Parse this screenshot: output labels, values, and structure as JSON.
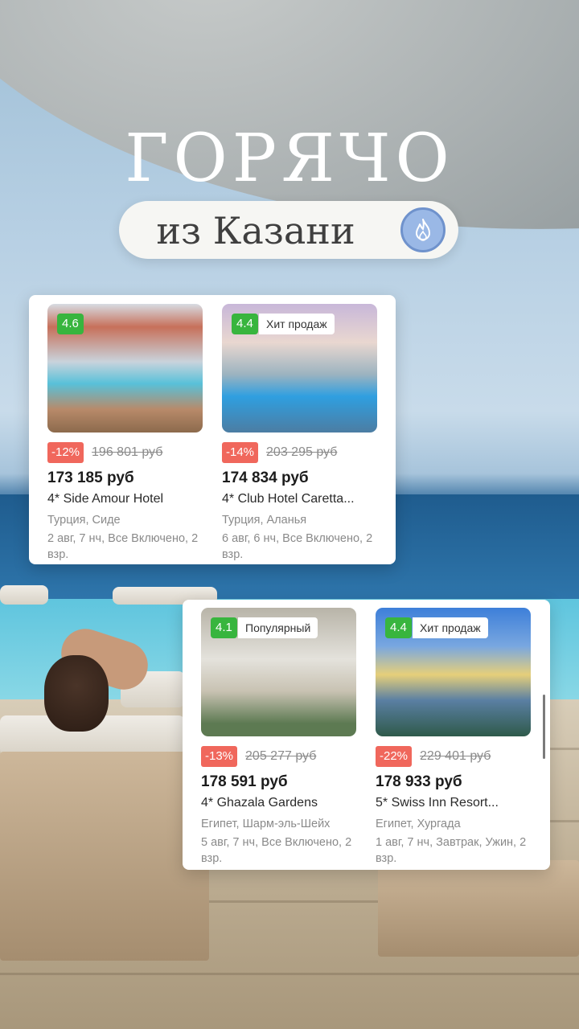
{
  "headline": "ГОРЯЧО",
  "subheadline": "из Казани",
  "icons": {
    "badge": "fire-icon"
  },
  "colors": {
    "rating": "#38b53e",
    "discount": "#f0675c",
    "pill_icon": "#9ab8e6"
  },
  "offers": [
    {
      "rating": "4.6",
      "tag": "",
      "discount": "-12%",
      "old_price": "196 801 руб",
      "price": "173 185 руб",
      "hotel": "4* Side Amour Hotel",
      "location": "Турция, Сиде",
      "details": "2 авг, 7 нч, Все Включено, 2 взр."
    },
    {
      "rating": "4.4",
      "tag": "Хит продаж",
      "discount": "-14%",
      "old_price": "203 295 руб",
      "price": "174 834 руб",
      "hotel": "4* Club Hotel Caretta...",
      "location": "Турция, Аланья",
      "details": "6 авг, 6 нч, Все Включено, 2 взр."
    },
    {
      "rating": "4.1",
      "tag": "Популярный",
      "discount": "-13%",
      "old_price": "205 277 руб",
      "price": "178 591 руб",
      "hotel": "4* Ghazala Gardens",
      "location": "Египет, Шарм-эль-Шейх",
      "details": "5 авг, 7 нч, Все Включено, 2 взр."
    },
    {
      "rating": "4.4",
      "tag": "Хит продаж",
      "discount": "-22%",
      "old_price": "229 401 руб",
      "price": "178 933 руб",
      "hotel": "5* Swiss Inn Resort...",
      "location": "Египет, Хургада",
      "details": "1 авг, 7 нч, Завтрак, Ужин, 2 взр."
    }
  ]
}
